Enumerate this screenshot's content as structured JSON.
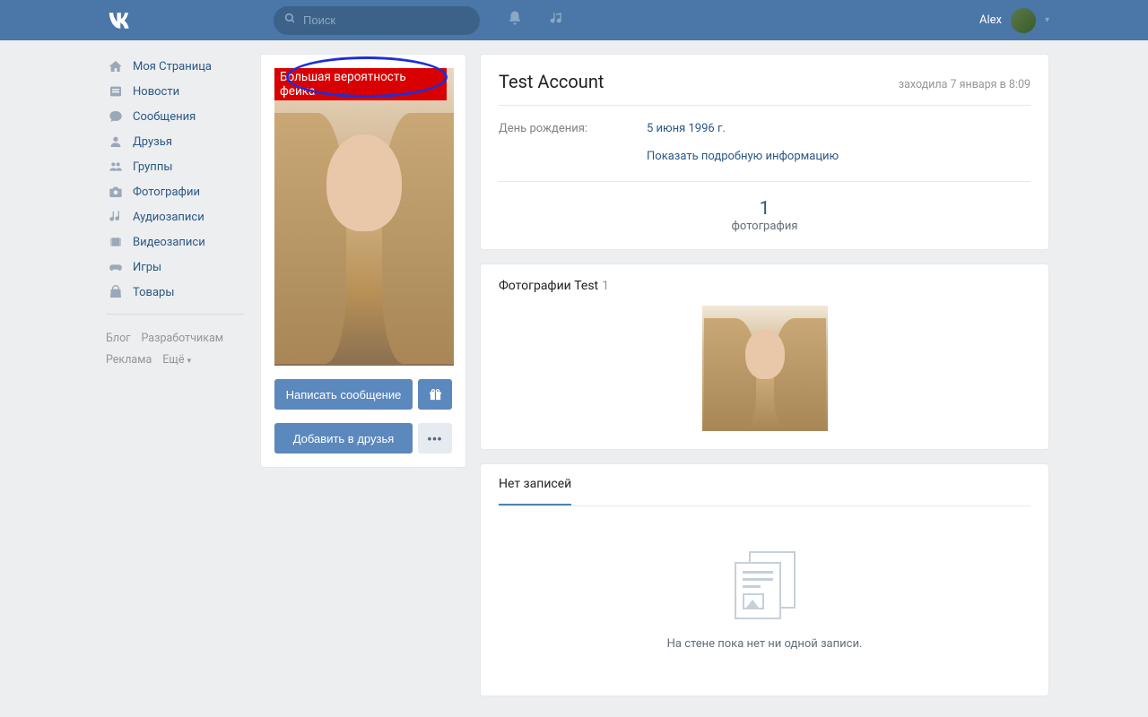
{
  "header": {
    "search_placeholder": "Поиск",
    "user_name": "Alex"
  },
  "nav": [
    {
      "key": "my-page",
      "label": "Моя Страница"
    },
    {
      "key": "news",
      "label": "Новости"
    },
    {
      "key": "messages",
      "label": "Сообщения"
    },
    {
      "key": "friends",
      "label": "Друзья"
    },
    {
      "key": "groups",
      "label": "Группы"
    },
    {
      "key": "photos",
      "label": "Фотографии"
    },
    {
      "key": "audio",
      "label": "Аудиозаписи"
    },
    {
      "key": "video",
      "label": "Видеозаписи"
    },
    {
      "key": "games",
      "label": "Игры"
    },
    {
      "key": "market",
      "label": "Товары"
    }
  ],
  "footer": {
    "blog": "Блог",
    "dev": "Разработчикам",
    "ads": "Реклама",
    "more": "Ещё"
  },
  "profile": {
    "fake_banner": "Большая вероятность фейка",
    "msg_btn": "Написать сообщение",
    "add_btn": "Добавить в друзья"
  },
  "info": {
    "name": "Test Account",
    "last_seen": "заходила 7 января в 8:09",
    "bday_label": "День рождения:",
    "bday_value": "5 июня 1996 г.",
    "more_info": "Показать подробную информацию",
    "count_num": "1",
    "count_label": "фотография"
  },
  "photos": {
    "title": "Фотографии Test",
    "count": "1"
  },
  "wall": {
    "tab": "Нет записей",
    "empty": "На стене пока нет ни одной записи."
  }
}
